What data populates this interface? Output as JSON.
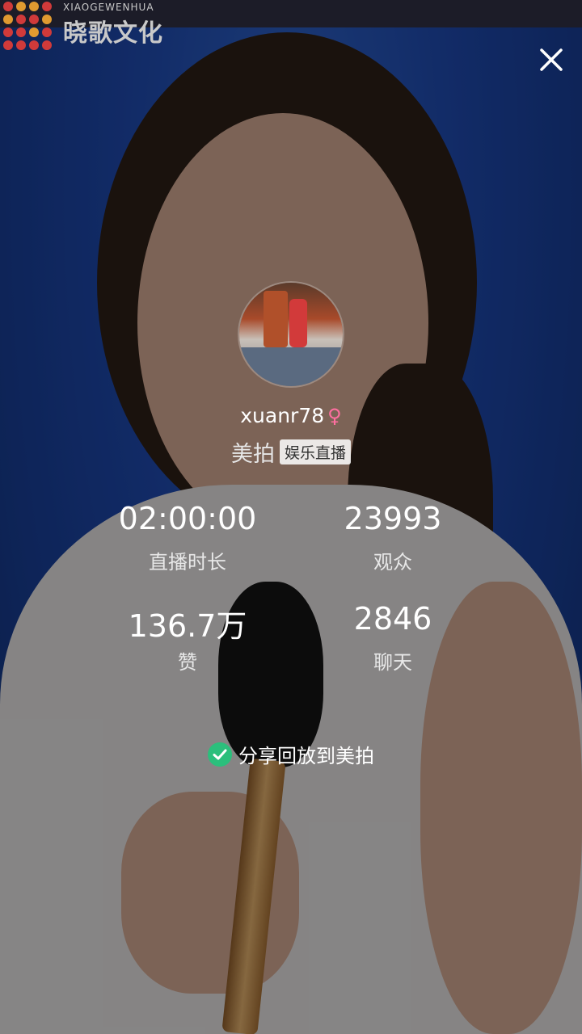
{
  "watermark": {
    "brand_en": "XIAOGEWENHUA",
    "brand_cn": "晓歌文化"
  },
  "header": {
    "close_icon": "close-icon"
  },
  "broadcaster": {
    "username": "xuanr78",
    "gender_symbol": "♀",
    "platform": "美拍",
    "category_badge": "娱乐直播"
  },
  "stats": {
    "duration": {
      "value": "02:00:00",
      "label": "直播时长"
    },
    "viewers": {
      "value": "23993",
      "label": "观众"
    },
    "likes": {
      "value": "136.7万",
      "label": "赞"
    },
    "chats": {
      "value": "2846",
      "label": "聊天"
    }
  },
  "share": {
    "checked": true,
    "label": "分享回放到美拍",
    "check_color": "#2bbf7c"
  },
  "colors": {
    "background_blue": "#1d46a6",
    "gender_pink": "#ff6fa0"
  }
}
